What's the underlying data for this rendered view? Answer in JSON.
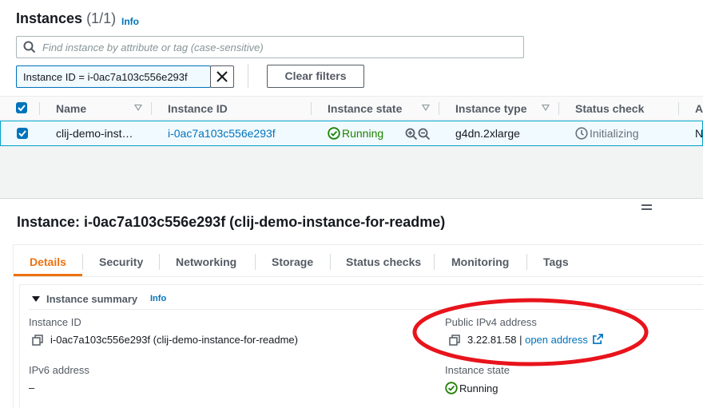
{
  "header": {
    "title": "Instances",
    "count": "(1/1)",
    "info_label": "Info"
  },
  "search": {
    "placeholder": "Find instance by attribute or tag (case-sensitive)"
  },
  "filter_chip": {
    "text": "Instance ID = i-0ac7a103c556e293f"
  },
  "clear_filters_label": "Clear filters",
  "table": {
    "columns": [
      "Name",
      "Instance ID",
      "Instance state",
      "Instance type",
      "Status check",
      "A"
    ],
    "rows": [
      {
        "name": "clij-demo-inst…",
        "instance_id": "i-0ac7a103c556e293f",
        "state": "Running",
        "type": "g4dn.2xlarge",
        "status_check": "Initializing",
        "extra": "N"
      }
    ]
  },
  "detail": {
    "title": "Instance: i-0ac7a103c556e293f (clij-demo-instance-for-readme)",
    "tabs": [
      "Details",
      "Security",
      "Networking",
      "Storage",
      "Status checks",
      "Monitoring",
      "Tags"
    ],
    "active_tab": "Details",
    "summary_title": "Instance summary",
    "summary_info": "Info",
    "fields": {
      "instance_id_label": "Instance ID",
      "instance_id_value": "i-0ac7a103c556e293f (clij-demo-instance-for-readme)",
      "ipv6_label": "IPv6 address",
      "ipv6_value": "–",
      "public_ipv4_label": "Public IPv4 address",
      "public_ipv4_value": "3.22.81.58",
      "public_ipv4_sep": "|",
      "open_address_label": "open address",
      "instance_state_label": "Instance state",
      "instance_state_value": "Running"
    }
  },
  "colors": {
    "accent_blue": "#0073bb",
    "active_tab_orange": "#ec7211",
    "running_green": "#1d8102",
    "annotation_red": "#e8141c"
  }
}
